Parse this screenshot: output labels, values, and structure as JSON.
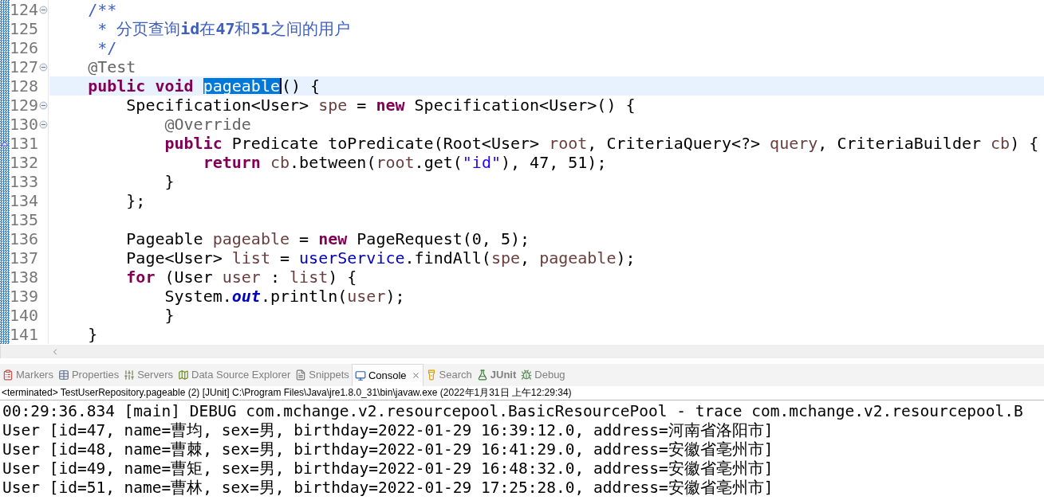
{
  "editor": {
    "lines": [
      {
        "number": "124",
        "folding": true,
        "override": false,
        "current": false,
        "tokens": [
          {
            "kind": "doc",
            "text": "    /**"
          }
        ]
      },
      {
        "number": "125",
        "folding": false,
        "override": false,
        "current": false,
        "tokens": [
          {
            "kind": "doc",
            "text": "     * 分页查询**id**在**47**和**51**之间的用户"
          }
        ]
      },
      {
        "number": "126",
        "folding": false,
        "override": false,
        "current": false,
        "tokens": [
          {
            "kind": "doc",
            "text": "     */"
          }
        ]
      },
      {
        "number": "127",
        "folding": true,
        "override": false,
        "current": false,
        "tokens": [
          {
            "kind": "ann",
            "text": "    @Test"
          }
        ]
      },
      {
        "number": "128",
        "folding": false,
        "override": false,
        "current": true,
        "tokens": [
          {
            "kind": "kw",
            "text": "    public void "
          },
          {
            "kind": "sel",
            "text": "pageable"
          },
          {
            "kind": "plain",
            "text": "() {"
          }
        ]
      },
      {
        "number": "129",
        "folding": true,
        "override": false,
        "current": false,
        "tokens": [
          {
            "kind": "plain",
            "text": "        Specification<User> "
          },
          {
            "kind": "local",
            "text": "spe"
          },
          {
            "kind": "plain",
            "text": " = "
          },
          {
            "kind": "kw",
            "text": "new"
          },
          {
            "kind": "plain",
            "text": " Specification<User>() {"
          }
        ]
      },
      {
        "number": "130",
        "folding": true,
        "override": false,
        "current": false,
        "tokens": [
          {
            "kind": "ann",
            "text": "            @Override"
          }
        ]
      },
      {
        "number": "131",
        "folding": false,
        "override": true,
        "current": false,
        "tokens": [
          {
            "kind": "kw",
            "text": "            public"
          },
          {
            "kind": "plain",
            "text": " Predicate toPredicate(Root<User> "
          },
          {
            "kind": "local",
            "text": "root"
          },
          {
            "kind": "plain",
            "text": ", CriteriaQuery<?> "
          },
          {
            "kind": "local",
            "text": "query"
          },
          {
            "kind": "plain",
            "text": ", CriteriaBuilder "
          },
          {
            "kind": "local",
            "text": "cb"
          },
          {
            "kind": "plain",
            "text": ") {"
          }
        ]
      },
      {
        "number": "132",
        "folding": false,
        "override": false,
        "current": false,
        "tokens": [
          {
            "kind": "kw",
            "text": "                return "
          },
          {
            "kind": "local",
            "text": "cb"
          },
          {
            "kind": "plain",
            "text": ".between("
          },
          {
            "kind": "local",
            "text": "root"
          },
          {
            "kind": "plain",
            "text": ".get("
          },
          {
            "kind": "str",
            "text": "\"id\""
          },
          {
            "kind": "plain",
            "text": "), 47, 51);"
          }
        ]
      },
      {
        "number": "133",
        "folding": false,
        "override": false,
        "current": false,
        "tokens": [
          {
            "kind": "plain",
            "text": "            }"
          }
        ]
      },
      {
        "number": "134",
        "folding": false,
        "override": false,
        "current": false,
        "tokens": [
          {
            "kind": "plain",
            "text": "        };"
          }
        ]
      },
      {
        "number": "135",
        "folding": false,
        "override": false,
        "current": false
      },
      {
        "number": "136",
        "folding": false,
        "override": false,
        "current": false,
        "tokens": [
          {
            "kind": "plain",
            "text": "        Pageable "
          },
          {
            "kind": "local",
            "text": "pageable"
          },
          {
            "kind": "plain",
            "text": " = "
          },
          {
            "kind": "kw",
            "text": "new"
          },
          {
            "kind": "plain",
            "text": " PageRequest(0, 5);"
          }
        ]
      },
      {
        "number": "137",
        "folding": false,
        "override": false,
        "current": false,
        "tokens": [
          {
            "kind": "plain",
            "text": "        Page<User> "
          },
          {
            "kind": "local",
            "text": "list"
          },
          {
            "kind": "plain",
            "text": " = "
          },
          {
            "kind": "field",
            "text": "userService"
          },
          {
            "kind": "plain",
            "text": ".findAll("
          },
          {
            "kind": "local",
            "text": "spe"
          },
          {
            "kind": "plain",
            "text": ", "
          },
          {
            "kind": "local",
            "text": "pageable"
          },
          {
            "kind": "plain",
            "text": ");"
          }
        ]
      },
      {
        "number": "138",
        "folding": false,
        "override": false,
        "current": false,
        "tokens": [
          {
            "kind": "kw",
            "text": "        for"
          },
          {
            "kind": "plain",
            "text": " (User "
          },
          {
            "kind": "local",
            "text": "user"
          },
          {
            "kind": "plain",
            "text": " : "
          },
          {
            "kind": "local",
            "text": "list"
          },
          {
            "kind": "plain",
            "text": ") {"
          }
        ]
      },
      {
        "number": "139",
        "folding": false,
        "override": false,
        "current": false,
        "tokens": [
          {
            "kind": "plain",
            "text": "            System."
          },
          {
            "kind": "static",
            "text": "out"
          },
          {
            "kind": "plain",
            "text": ".println("
          },
          {
            "kind": "local",
            "text": "user"
          },
          {
            "kind": "plain",
            "text": ");"
          }
        ]
      },
      {
        "number": "140",
        "folding": false,
        "override": false,
        "current": false,
        "tokens": [
          {
            "kind": "plain",
            "text": "            }"
          }
        ]
      },
      {
        "number": "141",
        "folding": false,
        "override": false,
        "current": false,
        "tokens": [
          {
            "kind": "plain",
            "text": "    }"
          }
        ]
      }
    ]
  },
  "views": {
    "tabs": [
      {
        "kind": "markers",
        "label": "Markers",
        "selected": false,
        "emphasized": false
      },
      {
        "kind": "properties",
        "label": "Properties",
        "selected": false,
        "emphasized": false
      },
      {
        "kind": "servers",
        "label": "Servers",
        "selected": false,
        "emphasized": false
      },
      {
        "kind": "datasource",
        "label": "Data Source Explorer",
        "selected": false,
        "emphasized": false
      },
      {
        "kind": "snippets",
        "label": "Snippets",
        "selected": false,
        "emphasized": false
      },
      {
        "kind": "console",
        "label": "Console",
        "selected": true,
        "emphasized": false
      },
      {
        "kind": "search",
        "label": "Search",
        "selected": false,
        "emphasized": false
      },
      {
        "kind": "junit",
        "label": "JUnit",
        "selected": false,
        "emphasized": true
      },
      {
        "kind": "debug",
        "label": "Debug",
        "selected": false,
        "emphasized": false
      }
    ]
  },
  "console": {
    "header": "<terminated> TestUserRepository.pageable (2) [JUnit] C:\\Program Files\\Java\\jre1.8.0_31\\bin\\javaw.exe (2022年1月31日 上午12:29:34)",
    "lines": [
      "00:29:36.834 [main] DEBUG com.mchange.v2.resourcepool.BasicResourcePool - trace com.mchange.v2.resourcepool.B",
      "User [id=47, name=曹均, sex=男, birthday=2022-01-29 16:39:12.0, address=河南省洛阳市]",
      "User [id=48, name=曹棘, sex=男, birthday=2022-01-29 16:41:29.0, address=安徽省亳州市]",
      "User [id=49, name=曹矩, sex=男, birthday=2022-01-29 16:48:32.0, address=安徽省亳州市]",
      "User [id=51, name=曹林, sex=男, birthday=2022-01-29 17:25:28.0, address=安徽省亳州市]"
    ]
  }
}
